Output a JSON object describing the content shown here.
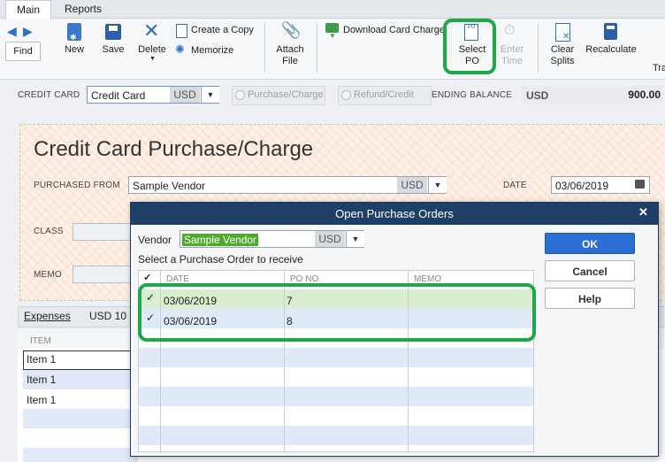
{
  "tabs": [
    "Main",
    "Reports"
  ],
  "toolbar": {
    "find": "Find",
    "new": "New",
    "save": "Save",
    "delete": "Delete",
    "create_copy": "Create a Copy",
    "memorize": "Memorize",
    "attach_line1": "Attach",
    "attach_line2": "File",
    "download": "Download Card Charges",
    "select_po_line1": "Select",
    "select_po_line2": "PO",
    "enter_time_line1": "Enter",
    "enter_time_line2": "Time",
    "clear_line1": "Clear",
    "clear_line2": "Splits",
    "recalculate": "Recalculate",
    "tra": "Tra"
  },
  "header_row": {
    "credit_card_label": "CREDIT CARD",
    "credit_card_value": "Credit Card",
    "currency": "USD",
    "purchase_charge": "Purchase/Charge",
    "refund_credit": "Refund/Credit",
    "ending_balance_label": "ENDING BALANCE",
    "ending_balance_currency": "USD",
    "ending_balance_value": "900.00"
  },
  "form": {
    "title": "Credit Card Purchase/Charge",
    "purchased_from_label": "PURCHASED FROM",
    "purchased_from_value": "Sample Vendor",
    "purchased_from_currency": "USD",
    "date_label": "DATE",
    "date_value": "03/06/2019",
    "class_label": "CLASS",
    "memo_label": "MEMO"
  },
  "expenses": {
    "tab": "Expenses",
    "currency_amount": "USD  10",
    "col_item": "ITEM",
    "items": [
      "Item 1",
      "Item 1",
      "Item 1"
    ]
  },
  "dialog": {
    "title": "Open Purchase Orders",
    "close": "✕",
    "vendor_label": "Vendor",
    "vendor_value": "Sample Vendor",
    "vendor_currency": "USD",
    "instruction": "Select a Purchase Order to receive",
    "col_check": "✓",
    "col_date": "DATE",
    "col_po": "PO NO.",
    "col_memo": "MEMO",
    "rows": [
      {
        "check": "✓",
        "date": "03/06/2019",
        "po": "7"
      },
      {
        "check": "✓",
        "date": "03/06/2019",
        "po": "8"
      }
    ],
    "ok": "OK",
    "cancel": "Cancel",
    "help": "Help"
  },
  "colors": {
    "highlight_green": "#1fa84a",
    "dialog_title_bg": "#1e3f66",
    "ok_blue": "#2b6fd6",
    "row_green": "#d9edd0",
    "row_blue": "#dfe9f7"
  }
}
